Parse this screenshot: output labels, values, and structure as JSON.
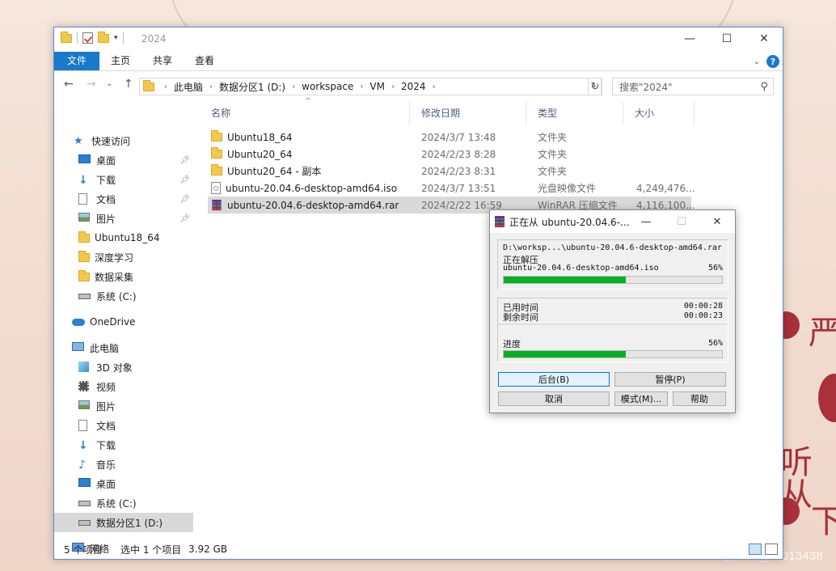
{
  "colors": {
    "accent": "#1979ca",
    "progress": "#06b025",
    "selection": "#d9d9d9",
    "wallpaper_red": "#a8313a"
  },
  "wallpaper": {
    "chars": [
      "严",
      "听从",
      "下"
    ],
    "watermark": "CSDN @2302_81013438"
  },
  "window": {
    "title": "2024",
    "controls": {
      "minimize": "—",
      "maximize": "☐",
      "close": "✕"
    }
  },
  "ribbon": {
    "tabs": [
      {
        "label": "文件"
      },
      {
        "label": "主页"
      },
      {
        "label": "共享"
      },
      {
        "label": "查看"
      }
    ],
    "expand_icon": "chevron-down-icon",
    "help_label": "?"
  },
  "nav": {
    "back": "←",
    "forward": "→",
    "recent": "⌄",
    "up": "↑",
    "breadcrumb": [
      "此电脑",
      "数据分区1 (D:)",
      "workspace",
      "VM",
      "2024"
    ],
    "refresh": "↻",
    "search_placeholder": "搜索\"2024\""
  },
  "sidebar": {
    "items": [
      {
        "label": "快速访问",
        "icon": "star-icon"
      },
      {
        "label": "桌面",
        "icon": "desktop-icon",
        "pinned": true
      },
      {
        "label": "下载",
        "icon": "download-icon",
        "pinned": true
      },
      {
        "label": "文档",
        "icon": "document-icon",
        "pinned": true
      },
      {
        "label": "图片",
        "icon": "picture-icon",
        "pinned": true
      },
      {
        "label": "Ubuntu18_64",
        "icon": "folder-icon"
      },
      {
        "label": "深度学习",
        "icon": "folder-icon"
      },
      {
        "label": "数据采集",
        "icon": "folder-icon"
      },
      {
        "label": "系统 (C:)",
        "icon": "drive-icon"
      },
      {
        "label": "OneDrive",
        "icon": "cloud-icon"
      },
      {
        "label": "此电脑",
        "icon": "computer-icon"
      },
      {
        "label": "3D 对象",
        "icon": "cube-icon"
      },
      {
        "label": "视频",
        "icon": "video-icon"
      },
      {
        "label": "图片",
        "icon": "picture-icon"
      },
      {
        "label": "文档",
        "icon": "document-icon"
      },
      {
        "label": "下载",
        "icon": "download-icon"
      },
      {
        "label": "音乐",
        "icon": "music-icon"
      },
      {
        "label": "桌面",
        "icon": "desktop-icon"
      },
      {
        "label": "系统 (C:)",
        "icon": "drive-icon"
      },
      {
        "label": "数据分区1 (D:)",
        "icon": "drive-icon",
        "selected": true
      },
      {
        "label": "网络",
        "icon": "network-icon"
      }
    ]
  },
  "files": {
    "columns": [
      "名称",
      "修改日期",
      "类型",
      "大小"
    ],
    "rows": [
      {
        "name": "Ubuntu18_64",
        "date": "2024/3/7 13:48",
        "type": "文件夹",
        "size": "",
        "icon": "folder-icon"
      },
      {
        "name": "Ubuntu20_64",
        "date": "2024/2/23 8:28",
        "type": "文件夹",
        "size": "",
        "icon": "folder-icon"
      },
      {
        "name": "Ubuntu20_64 - 副本",
        "date": "2024/2/23 8:31",
        "type": "文件夹",
        "size": "",
        "icon": "folder-icon"
      },
      {
        "name": "ubuntu-20.04.6-desktop-amd64.iso",
        "date": "2024/3/7 13:51",
        "type": "光盘映像文件",
        "size": "4,249,476...",
        "icon": "disc-image-icon"
      },
      {
        "name": "ubuntu-20.04.6-desktop-amd64.rar",
        "date": "2024/2/22 16:59",
        "type": "WinRAR 压缩文件",
        "size": "4,116,100...",
        "icon": "winrar-icon",
        "selected": true
      }
    ]
  },
  "status": {
    "count": "5 个项目",
    "selection": "选中 1 个项目",
    "size": "3.92 GB"
  },
  "rar_dialog": {
    "title": "正在从 ubuntu-20.04.6-...",
    "path": "D:\\worksp...\\ubuntu-20.04.6-desktop-amd64.rar",
    "action": "正在解压",
    "file": "ubuntu-20.04.6-desktop-amd64.iso",
    "file_percent": "56%",
    "file_progress": 0.56,
    "elapsed_label": "已用时间",
    "elapsed": "00:00:28",
    "remaining_label": "剩余时间",
    "remaining": "00:00:23",
    "progress_label": "进度",
    "total_percent": "56%",
    "total_progress": 0.56,
    "buttons": {
      "background": "后台(B)",
      "pause": "暂停(P)",
      "cancel": "取消",
      "mode": "模式(M)...",
      "help": "帮助"
    }
  }
}
